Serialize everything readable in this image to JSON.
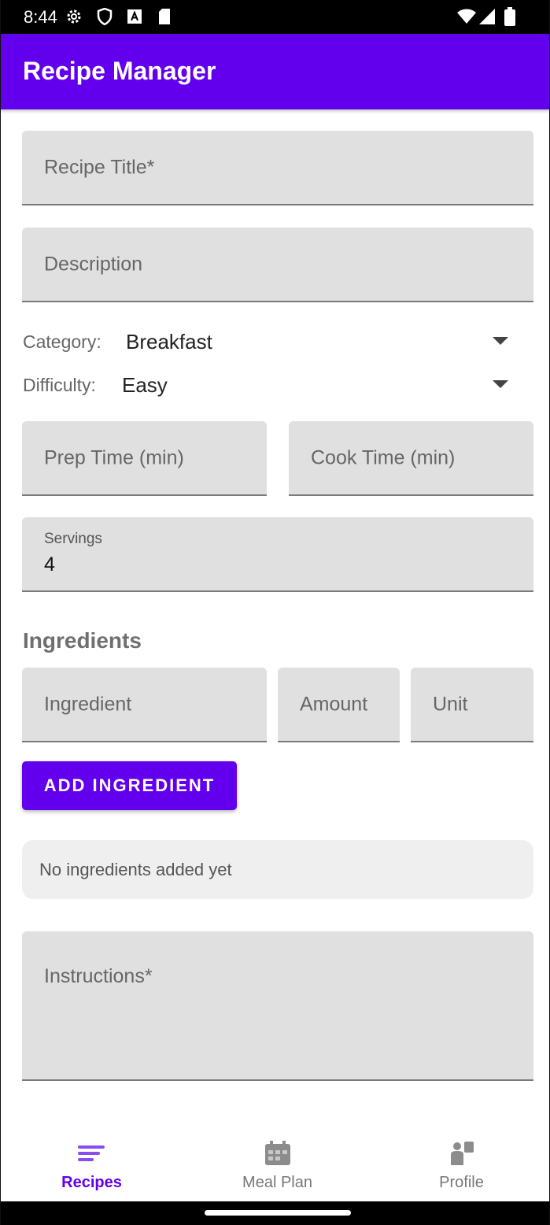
{
  "status_bar": {
    "time": "8:44",
    "icons": [
      "gear-icon",
      "shield-icon",
      "a-icon",
      "sd-card-icon",
      "wifi-icon",
      "signal-icon",
      "battery-icon"
    ]
  },
  "app_bar": {
    "title": "Recipe Manager",
    "color": "#6200ee"
  },
  "form": {
    "title_placeholder": "Recipe Title*",
    "description_placeholder": "Description",
    "category": {
      "label": "Category:",
      "value": "Breakfast"
    },
    "difficulty": {
      "label": "Difficulty:",
      "value": "Easy"
    },
    "prep_time_placeholder": "Prep Time (min)",
    "cook_time_placeholder": "Cook Time (min)",
    "servings": {
      "label": "Servings",
      "value": "4"
    },
    "ingredients_heading": "Ingredients",
    "ingredient_placeholder": "Ingredient",
    "amount_placeholder": "Amount",
    "unit_placeholder": "Unit",
    "add_ingredient_label": "ADD INGREDIENT",
    "empty_ingredients_text": "No ingredients added yet",
    "instructions_placeholder": "Instructions*"
  },
  "bottom_nav": {
    "items": [
      {
        "label": "Recipes",
        "icon": "list-icon",
        "active": true
      },
      {
        "label": "Meal Plan",
        "icon": "calendar-icon",
        "active": false
      },
      {
        "label": "Profile",
        "icon": "profile-icon",
        "active": false
      }
    ]
  }
}
